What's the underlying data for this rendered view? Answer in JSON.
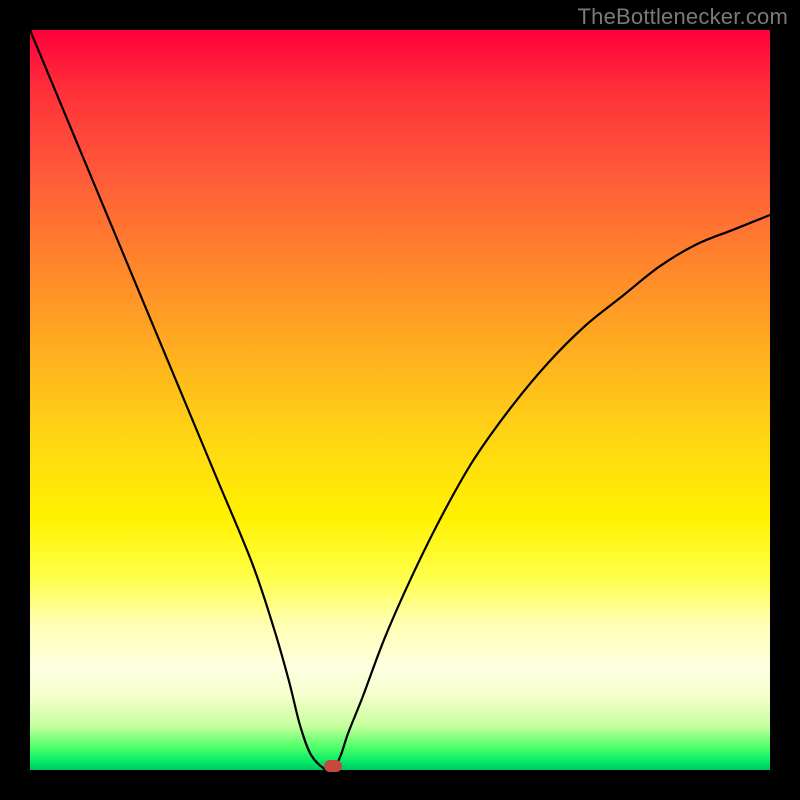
{
  "watermark": "TheBottlenecker.com",
  "chart_data": {
    "type": "line",
    "title": "",
    "xlabel": "",
    "ylabel": "",
    "xlim": [
      0,
      100
    ],
    "ylim": [
      0,
      100
    ],
    "gradient_meaning": "background vertical gradient from red (top, high bottleneck) to green (bottom, 0% bottleneck)",
    "series": [
      {
        "name": "bottleneck-curve",
        "x": [
          0,
          5,
          10,
          15,
          20,
          25,
          30,
          33,
          35,
          36.5,
          38,
          40,
          41,
          42,
          43,
          45,
          48,
          52,
          56,
          60,
          65,
          70,
          75,
          80,
          85,
          90,
          95,
          100
        ],
        "y": [
          100,
          88,
          76,
          64,
          52,
          40,
          28,
          19,
          12,
          6,
          2,
          0,
          0,
          2,
          5,
          10,
          18,
          27,
          35,
          42,
          49,
          55,
          60,
          64,
          68,
          71,
          73,
          75
        ]
      }
    ],
    "marker": {
      "x": 41,
      "y": 0,
      "label": "optimal-point"
    }
  }
}
